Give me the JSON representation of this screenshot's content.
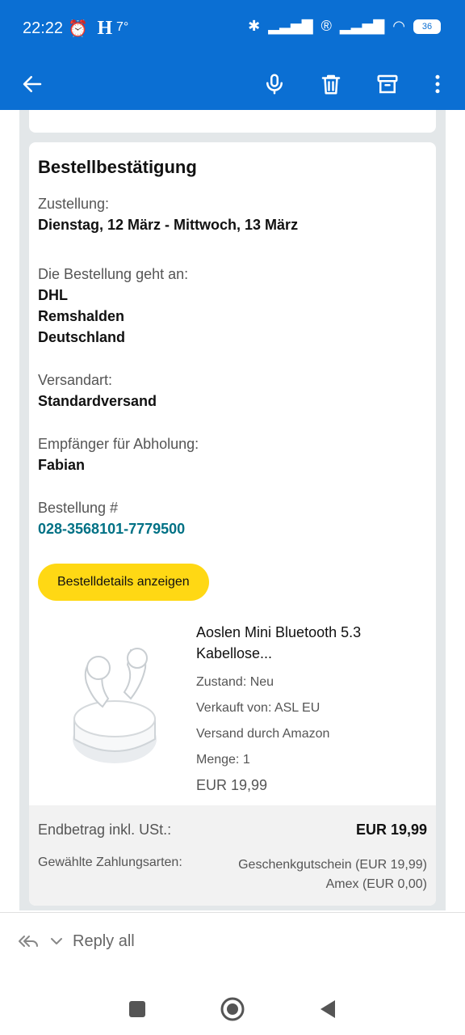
{
  "status_bar": {
    "time": "22:22",
    "indicator_h": "H",
    "temperature": "7°",
    "battery": "36"
  },
  "appbar": {
    "icons": [
      "arrow-back-icon",
      "microphone-icon",
      "trash-icon",
      "archive-icon",
      "more-vert-icon"
    ]
  },
  "order": {
    "title": "Bestellbestätigung",
    "delivery_label": "Zustellung:",
    "delivery_value": "Dienstag, 12 März - Mittwoch, 13 März",
    "shipto_label": "Die Bestellung geht an:",
    "shipto_line1": "DHL",
    "shipto_line2": "Remshalden",
    "shipto_line3": "Deutschland",
    "shipping_label": "Versandart:",
    "shipping_value": "Standardversand",
    "pickup_label": "Empfänger für Abholung:",
    "pickup_value": "Fabian",
    "ordernum_label": "Bestellung #",
    "ordernum_value": "028-3568101-7779500",
    "details_button": "Bestelldetails anzeigen",
    "product": {
      "name_line1": "Aoslen Mini Bluetooth 5.3",
      "name_line2": "Kabellose...",
      "condition": "Zustand: Neu",
      "seller": "Verkauft von: ASL EU",
      "shipping": "Versand durch Amazon",
      "quantity": "Menge: 1",
      "price": "EUR 19,99"
    },
    "summary": {
      "total_label": "Endbetrag inkl. USt.:",
      "total_value": "EUR 19,99",
      "payment_label": "Gewählte Zahlungsarten:",
      "payment_line1": "Geschenkgutschein (EUR 19,99)",
      "payment_line2": "Amex (EUR 0,00)"
    }
  },
  "bottom": {
    "reply_label": "Reply all"
  },
  "colors": {
    "brand_blue": "#0b6fd3",
    "button_yellow": "#ffd814",
    "link_teal": "#007185"
  }
}
